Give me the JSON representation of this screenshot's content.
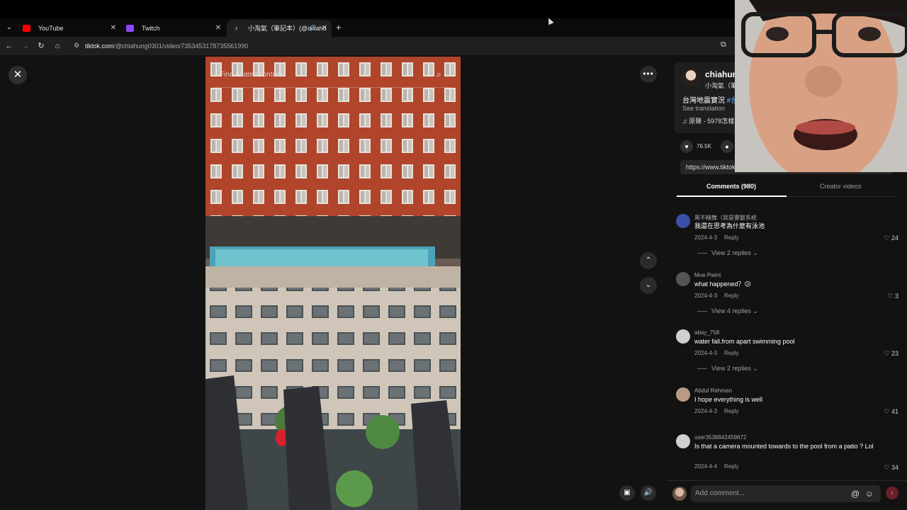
{
  "browser": {
    "tabs": [
      {
        "label": "YouTube",
        "favicon": "youtube-icon",
        "color": "#ff0000",
        "active": false
      },
      {
        "label": "Twitch",
        "favicon": "twitch-icon",
        "color": "#9146ff",
        "active": false
      },
      {
        "label": "小淘氣（筆記本）(@chiahu",
        "favicon": "tiktok-icon",
        "color": "#ffffff",
        "active": true
      }
    ],
    "new_tab": "+",
    "url_domain": "tiktok.com",
    "url_path": "/@chiahung0301/video/7353453178735561990"
  },
  "video": {
    "search_placeholder": "Find related content"
  },
  "author": {
    "username": "chiahun",
    "nickname": "小淘氣（筆",
    "description": "台灣地震實況",
    "hashtag": "#台",
    "see_translation": "See translation",
    "music": "原聲 - 5978怎樣",
    "likes": "76.5K",
    "comments": "980",
    "link": "https://www.tiktok.com/@ch"
  },
  "tabs": {
    "comments": "Comments (980)",
    "creator_videos": "Creator videos"
  },
  "comments": [
    {
      "user": "黑不精舞（就是靈獸系統",
      "text": "我還在思考為什麼有泳池",
      "date": "2024-4-3",
      "reply": "Reply",
      "likes": "24",
      "replies": "View 2 replies",
      "avatar_color": "#3a4fa8"
    },
    {
      "user": "Moe Pwint",
      "text": "what happened？😕",
      "date": "2024-4-3",
      "reply": "Reply",
      "likes": "3",
      "replies": "View 4 replies",
      "avatar_color": "#555555"
    },
    {
      "user": "abay_758",
      "text": "water fall.from apart swimming pool",
      "date": "2024-4-3",
      "reply": "Reply",
      "likes": "23",
      "replies": "View 2 replies",
      "avatar_color": "#cfcfcf"
    },
    {
      "user": "Abdul Rehman",
      "text": "I hope everything is well",
      "date": "2024-4-3",
      "reply": "Reply",
      "likes": "41",
      "replies": "",
      "avatar_color": "#b89b82"
    },
    {
      "user": "user3538842459672",
      "text": "Is that a camera mounted towards to the pool from a patio ? Lol",
      "date": "2024-4-4",
      "reply": "Reply",
      "likes": "34",
      "replies": "",
      "avatar_color": "#d0d0d0"
    }
  ],
  "add_comment": {
    "placeholder": "Add comment...",
    "at": "@",
    "emoji": "☺"
  },
  "icons": {
    "close": "✕",
    "more": "•••",
    "up": "⌃",
    "down": "⌄"
  }
}
